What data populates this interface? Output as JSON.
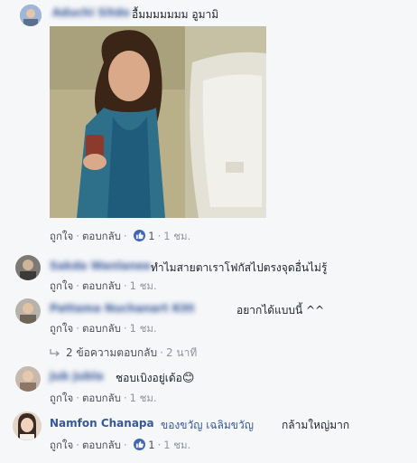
{
  "comments": [
    {
      "author": "Aduchi Sitdo",
      "text": "อื้มมมมมมม อูมามิ",
      "actions": {
        "like": "ถูกใจ",
        "reply": "ตอบกลับ",
        "reactions": "1",
        "time": "1 ชม."
      }
    },
    {
      "author": "Sakda Wanlanee",
      "text": "ทำไมสายตาเราโฟกัสไปตรงจุดอื่นไม่รู้",
      "actions": {
        "like": "ถูกใจ",
        "reply": "ตอบกลับ",
        "time": "1 ชม."
      }
    },
    {
      "author": "Pattama Nuchanart Kitt",
      "text": "อยากได้แบบนี้ ^^",
      "actions": {
        "like": "ถูกใจ",
        "reply": "ตอบกลับ",
        "time": "1 ชม."
      },
      "replies": {
        "label": "2 ข้อความตอบกลับ",
        "time": "2 นาที"
      }
    },
    {
      "author": "Jub Jubla",
      "text": "ชอบเบิงอยู่เด้อ",
      "emoji": "😊",
      "actions": {
        "like": "ถูกใจ",
        "reply": "ตอบกลับ",
        "time": "1 ชม."
      }
    },
    {
      "author": "Namfon Chanapa",
      "mention": "ของขวัญ เฉลิมขวัญ",
      "text": "กล้ามใหญ่มาก",
      "actions": {
        "like": "ถูกใจ",
        "reply": "ตอบกลับ",
        "reactions": "1",
        "time": "1 ชม."
      }
    }
  ],
  "colors": {
    "link": "#365899",
    "meta": "#90949c",
    "like_badge": "#4267b2",
    "background": "#f6f7f9"
  },
  "icons": [
    "like-reaction-icon",
    "reply-arrow-icon",
    "smile-emoji-icon"
  ]
}
